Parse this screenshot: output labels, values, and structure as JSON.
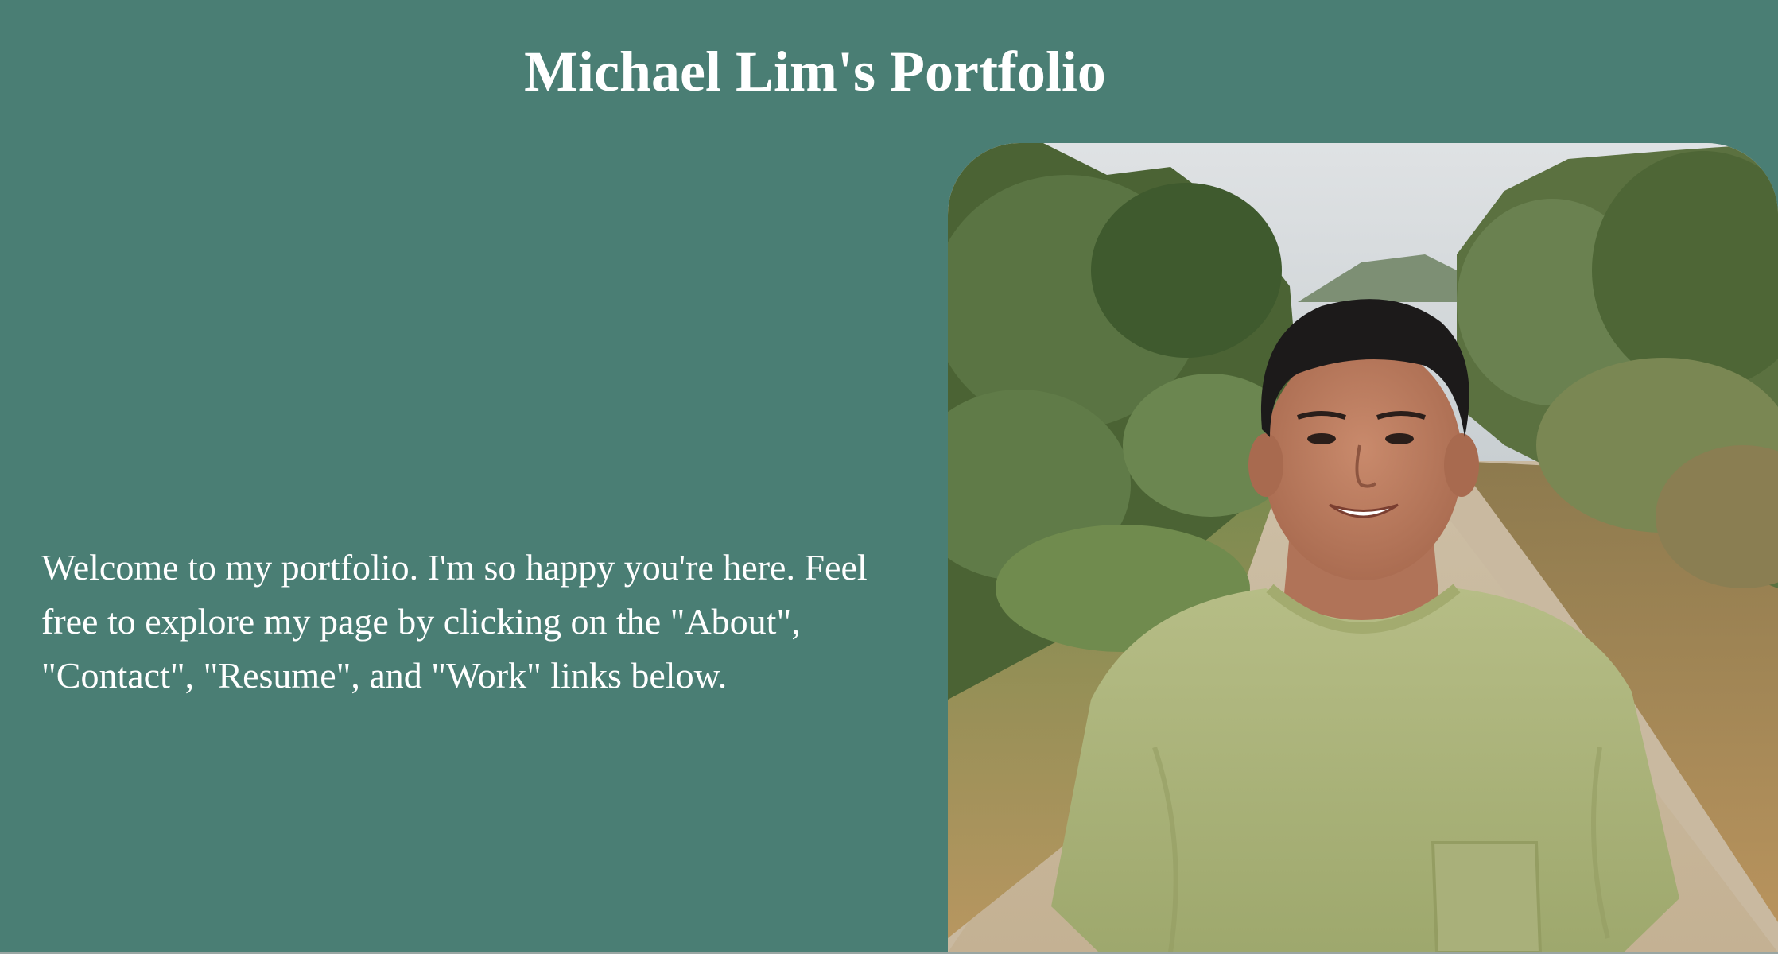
{
  "header": {
    "title": "Michael Lim's Portfolio"
  },
  "main": {
    "intro_text": "Welcome to my portfolio. I'm so happy you're here. Feel free to explore my page by clicking on the \"About\", \"Contact\", \"Resume\", and \"Work\" links below."
  },
  "colors": {
    "background": "#4a7e74",
    "text": "#ffffff"
  },
  "photo": {
    "subject": "portrait-photo"
  }
}
